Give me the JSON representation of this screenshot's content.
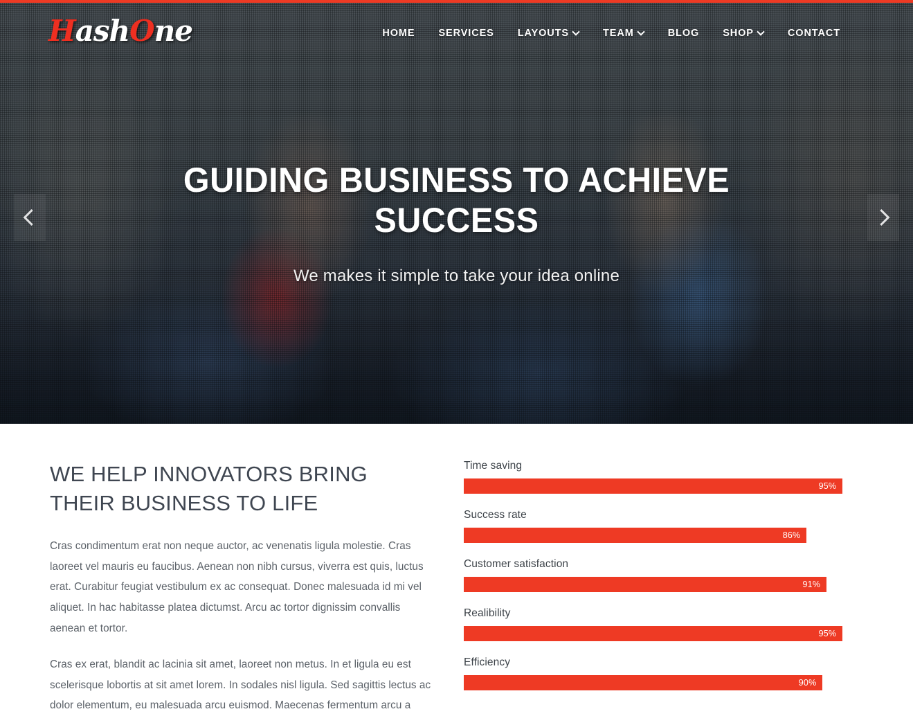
{
  "theme": {
    "accent": "#ee3a24",
    "header_text": "#ffffff",
    "heading_text": "#3f4651",
    "body_text": "#5b6168"
  },
  "header": {
    "logo": {
      "full": "HashOne",
      "part1": "H",
      "part2": "ash",
      "part3": "O",
      "part4": "ne"
    },
    "nav": [
      {
        "label": "HOME",
        "has_dropdown": false
      },
      {
        "label": "SERVICES",
        "has_dropdown": false
      },
      {
        "label": "LAYOUTS",
        "has_dropdown": true
      },
      {
        "label": "TEAM",
        "has_dropdown": true
      },
      {
        "label": "BLOG",
        "has_dropdown": false
      },
      {
        "label": "SHOP",
        "has_dropdown": true
      },
      {
        "label": "CONTACT",
        "has_dropdown": false
      }
    ]
  },
  "hero": {
    "title": "GUIDING BUSINESS TO ACHIEVE SUCCESS",
    "subtitle": "We makes it simple to take your idea online",
    "prev_label": "Previous slide",
    "next_label": "Next slide"
  },
  "about": {
    "title": "WE HELP INNOVATORS BRING THEIR BUSINESS TO LIFE",
    "paragraphs": [
      "Cras condimentum erat non neque auctor, ac venenatis ligula molestie. Cras laoreet vel mauris eu faucibus. Aenean non nibh cursus, viverra est quis, luctus erat. Curabitur feugiat vestibulum ex ac consequat. Donec malesuada id mi vel aliquet. In hac habitasse platea dictumst. Arcu ac tortor dignissim convallis aenean et tortor.",
      "Cras ex erat, blandit ac lacinia sit amet, laoreet non metus. In et ligula eu est scelerisque lobortis at sit amet lorem. In sodales nisl ligula. Sed sagittis lectus ac dolor elementum, eu malesuada arcu euismod. Maecenas fermentum arcu a"
    ]
  },
  "chart_data": {
    "type": "bar",
    "title": "",
    "orientation": "horizontal",
    "categories": [
      "Time saving",
      "Success rate",
      "Customer satisfaction",
      "Realibility",
      "Efficiency"
    ],
    "values": [
      95,
      86,
      91,
      95,
      90
    ],
    "value_labels": [
      "95%",
      "86%",
      "91%",
      "95%",
      "90%"
    ],
    "xlabel": "",
    "ylabel": "",
    "xlim": [
      0,
      100
    ],
    "unit": "%",
    "grid": false,
    "legend": false,
    "bar_color": "#ee3a24"
  },
  "skills": [
    {
      "label": "Time saving",
      "value": 95,
      "value_label": "95%"
    },
    {
      "label": "Success rate",
      "value": 86,
      "value_label": "86%"
    },
    {
      "label": "Customer satisfaction",
      "value": 91,
      "value_label": "91%"
    },
    {
      "label": "Realibility",
      "value": 95,
      "value_label": "95%"
    },
    {
      "label": "Efficiency",
      "value": 90,
      "value_label": "90%"
    }
  ]
}
